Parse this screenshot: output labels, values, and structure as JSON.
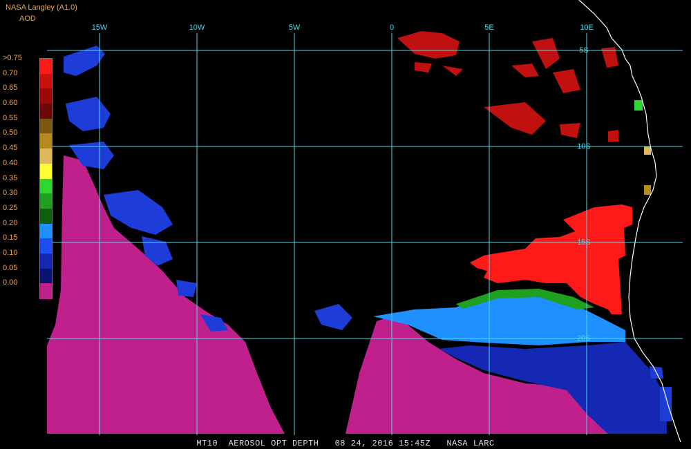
{
  "header": {
    "title": "NASA Langley (A1.0)",
    "product": "AOD"
  },
  "map": {
    "lon_labels": [
      "15W",
      "10W",
      "5W",
      "0",
      "5E",
      "10E"
    ],
    "lon_values": [
      -15,
      -10,
      -5,
      0,
      5,
      10
    ],
    "lat_labels": [
      "5S",
      "10S",
      "15S",
      "20S"
    ],
    "lat_values": [
      -5,
      -10,
      -15,
      -20
    ]
  },
  "legend": {
    "ticks": [
      ">0.75",
      "0.70",
      "0.65",
      "0.60",
      "0.55",
      "0.50",
      "0.45",
      "0.40",
      "0.35",
      "0.30",
      "0.25",
      "0.20",
      "0.15",
      "0.10",
      "0.05",
      "0.00"
    ],
    "colors": [
      "#ff1a1a",
      "#cc1010",
      "#a00808",
      "#6e0808",
      "#7a5a10",
      "#b88a1e",
      "#e0b85c",
      "#ffff33",
      "#2ed82e",
      "#1fa01f",
      "#0f5f0f",
      "#1e90ff",
      "#1e4ef0",
      "#1428b4",
      "#0a1470",
      "#c0208c"
    ]
  },
  "footer": {
    "text": "MT10  AEROSOL OPT DEPTH   08 24, 2016 15:45Z   NASA LARC"
  }
}
